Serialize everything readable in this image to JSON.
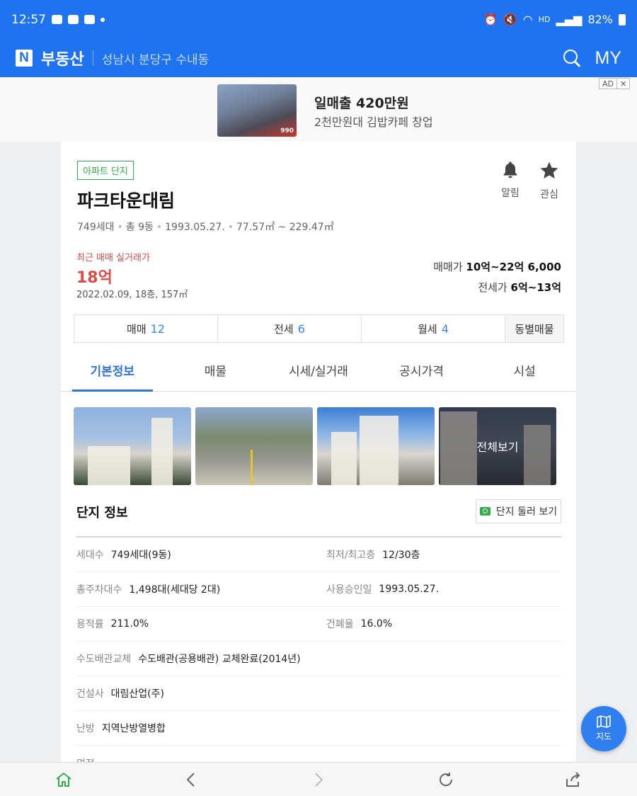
{
  "status": {
    "time": "12:57",
    "network": "HD",
    "battery": "82%"
  },
  "header": {
    "brand": "부동산",
    "logo_letter": "N",
    "location": "성남시 분당구 수내동",
    "my_label": "MY"
  },
  "ad": {
    "title": "일매출 420만원",
    "subtitle": "2천만원대 김밥카페 창업",
    "badge": "AD",
    "close": "✕",
    "image_caption": "990"
  },
  "complex": {
    "tag": "아파트 단지",
    "name": "파크타운대림",
    "meta": [
      "749세대",
      "총 9동",
      "1993.05.27.",
      "77.57㎡ ~ 229.47㎡"
    ],
    "alarm_label": "알림",
    "fav_label": "관심",
    "recent": {
      "label": "최근 매매 실거래가",
      "price": "18억",
      "detail": "2022.02.09, 18층, 157㎡"
    },
    "sale": {
      "label": "매매가",
      "value": "10억~22억 6,000"
    },
    "jeonse": {
      "label": "전세가",
      "value": "6억~13억"
    }
  },
  "type_tabs": [
    {
      "label": "매매",
      "count": "12"
    },
    {
      "label": "전세",
      "count": "6"
    },
    {
      "label": "월세",
      "count": "4"
    },
    {
      "label": "동별매물"
    }
  ],
  "main_tabs": [
    "기본정보",
    "매물",
    "시세/실거래",
    "공시가격",
    "시설"
  ],
  "photos": {
    "view_all": "전체보기"
  },
  "section": {
    "title": "단지 정보",
    "tour_button": "단지 둘러 보기"
  },
  "info_rows": [
    [
      {
        "label": "세대수",
        "value": "749세대(9동)"
      },
      {
        "label": "최저/최고층",
        "value": "12/30층"
      }
    ],
    [
      {
        "label": "총주차대수",
        "value": "1,498대(세대당 2대)"
      },
      {
        "label": "사용승인일",
        "value": "1993.05.27."
      }
    ],
    [
      {
        "label": "용적률",
        "value": "211.0%"
      },
      {
        "label": "건폐율",
        "value": "16.0%"
      }
    ],
    [
      {
        "label": "수도배관교체",
        "value": "수도배관(공용배관) 교체완료(2014년)"
      }
    ],
    [
      {
        "label": "건설사",
        "value": "대림산업(주)"
      }
    ],
    [
      {
        "label": "난방",
        "value": "지역난방열병합"
      }
    ],
    [
      {
        "label": "면적",
        "value": ""
      }
    ]
  ],
  "map_fab": {
    "label": "지도"
  },
  "colors": {
    "primary": "#1f72f0",
    "accent_blue": "#2f76d8",
    "price_red": "#e04a4a",
    "tag_green": "#2fae4a"
  }
}
